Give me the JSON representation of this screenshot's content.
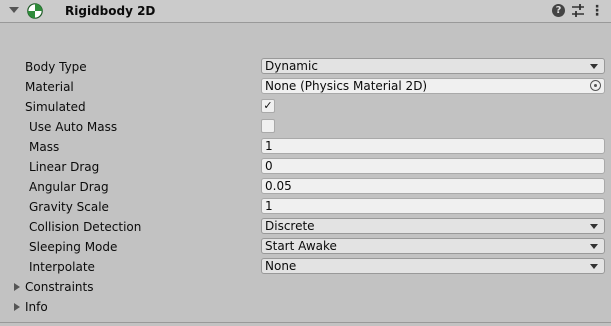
{
  "component": {
    "title": "Rigidbody 2D",
    "help_glyph": "?",
    "menu_glyph": "⋮"
  },
  "properties": {
    "body_type": {
      "label": "Body Type",
      "value": "Dynamic"
    },
    "material": {
      "label": "Material",
      "value": "None (Physics Material 2D)"
    },
    "simulated": {
      "label": "Simulated",
      "checked": true,
      "check_glyph": "✓"
    },
    "use_auto_mass": {
      "label": "Use Auto Mass",
      "checked": false,
      "check_glyph": ""
    },
    "mass": {
      "label": "Mass",
      "value": "1"
    },
    "linear_drag": {
      "label": "Linear Drag",
      "value": "0"
    },
    "angular_drag": {
      "label": "Angular Drag",
      "value": "0.05"
    },
    "gravity_scale": {
      "label": "Gravity Scale",
      "value": "1"
    },
    "collision_detection": {
      "label": "Collision Detection",
      "value": "Discrete"
    },
    "sleeping_mode": {
      "label": "Sleeping Mode",
      "value": "Start Awake"
    },
    "interpolate": {
      "label": "Interpolate",
      "value": "None"
    }
  },
  "foldouts": {
    "constraints": "Constraints",
    "info": "Info"
  },
  "colors": {
    "panel_bg": "#c2c2c2",
    "header_bg": "#cbcbcb",
    "field_bg": "#f0f0f0",
    "icon_green": "#2e8b3a"
  }
}
